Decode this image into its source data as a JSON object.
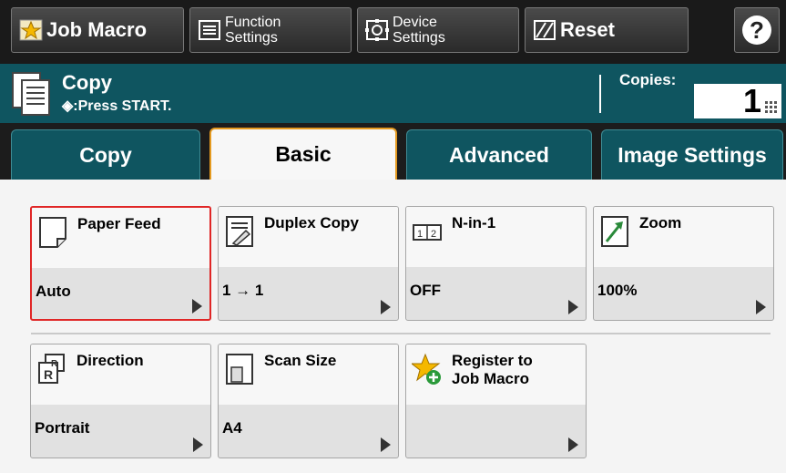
{
  "toolbar": {
    "job_macro": "Job Macro",
    "function_settings_line1": "Function",
    "function_settings_line2": "Settings",
    "device_settings_line1": "Device",
    "device_settings_line2": "Settings",
    "reset": "Reset",
    "help": "?"
  },
  "status": {
    "title": "Copy",
    "subtitle": "◈:Press START.",
    "copies_label": "Copies:",
    "copies_value": "1"
  },
  "tabs": [
    {
      "label": "Copy",
      "selected": false
    },
    {
      "label": "Basic",
      "selected": true
    },
    {
      "label": "Advanced",
      "selected": false
    },
    {
      "label": "Image Settings",
      "selected": false
    }
  ],
  "functions": {
    "paper_feed": {
      "name": "Paper Feed",
      "value": "Auto",
      "icon": "paper-icon"
    },
    "duplex_copy": {
      "name": "Duplex Copy",
      "value": "1 → 1",
      "icon": "duplex-icon"
    },
    "n_in_1": {
      "name": "N-in-1",
      "value": "OFF",
      "icon": "n-in-1-icon"
    },
    "zoom": {
      "name": "Zoom",
      "value": "100%",
      "icon": "zoom-icon"
    },
    "direction": {
      "name": "Direction",
      "value": "Portrait",
      "icon": "direction-icon"
    },
    "scan_size": {
      "name": "Scan Size",
      "value": "A4",
      "icon": "scan-size-icon"
    },
    "register_macro": {
      "name_line1": "Register to",
      "name_line2": "Job Macro",
      "value": "",
      "icon": "star-add-icon"
    }
  },
  "colors": {
    "status_bg": "#0f5560",
    "active_tab_border": "#e49a20",
    "selected_outline": "#e02626"
  }
}
